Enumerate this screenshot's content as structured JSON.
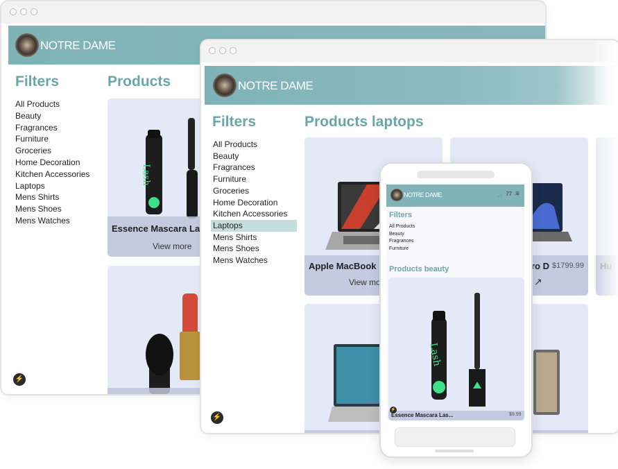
{
  "brand": {
    "name": "NOTRE DAME"
  },
  "back_window": {
    "filters_heading": "Filters",
    "products_heading": "Products",
    "filters": [
      "All Products",
      "Beauty",
      "Fragrances",
      "Furniture",
      "Groceries",
      "Home Decoration",
      "Kitchen Accessories",
      "Laptops",
      "Mens Shirts",
      "Mens Shoes",
      "Mens Watches"
    ],
    "card1": {
      "title": "Essence Mascara Lash Princess",
      "view_more": "View more"
    }
  },
  "front_window": {
    "filters_heading": "Filters",
    "products_heading": "Products laptops",
    "filters": [
      "All Products",
      "Beauty",
      "Fragrances",
      "Furniture",
      "Groceries",
      "Home Decoration",
      "Kitchen Accessories",
      "Laptops",
      "Mens Shirts",
      "Mens Shoes",
      "Mens Watches"
    ],
    "selected_filter": "Laptops",
    "card1": {
      "title": "Apple MacBook Pro 14 Inch Space Grey",
      "view_more": "View more"
    },
    "card2": {
      "title": "Asus Zenbook Pro D...",
      "price": "$1799.99"
    },
    "card3": {
      "title": "Hu"
    }
  },
  "phone": {
    "cart_count": "77",
    "filters_heading": "Filters",
    "filters": [
      "All Products",
      "Beauty",
      "Fragrances",
      "Furniture"
    ],
    "products_heading": "Products beauty",
    "card": {
      "title": "Essence Mascara Las...",
      "price": "$9.99"
    }
  },
  "icons": {
    "bolt": "lightning-bolt-icon",
    "cart": "cart-icon",
    "menu": "hamburger-menu-icon",
    "arrow": "arrow-up-right-icon"
  },
  "colors": {
    "accent": "#6aa5ab",
    "header": "#7fb3b8",
    "card": "#e5e9f7",
    "selected": "#c6dde0"
  }
}
